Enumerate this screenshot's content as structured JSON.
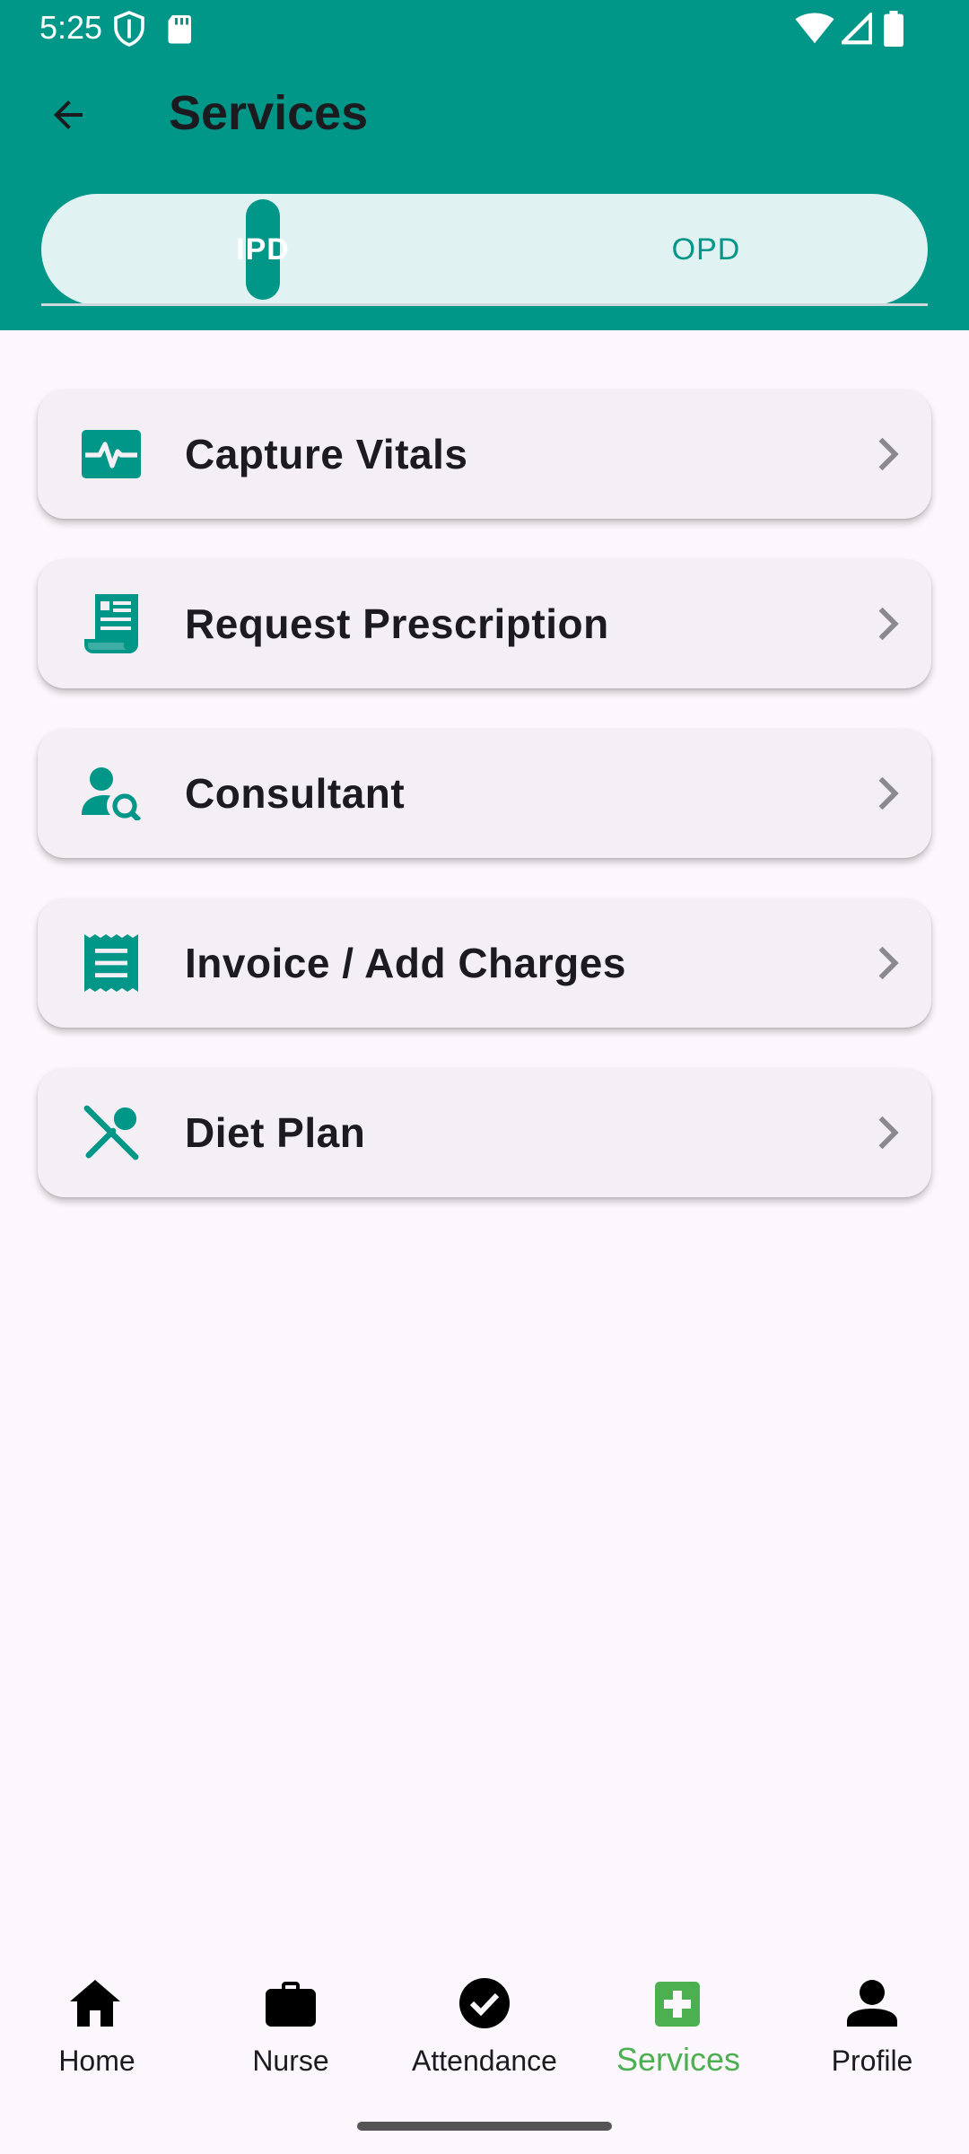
{
  "status_bar": {
    "time": "5:25"
  },
  "header": {
    "title": "Services"
  },
  "tabs": [
    {
      "label": "IPD",
      "selected": true
    },
    {
      "label": "OPD",
      "selected": false
    }
  ],
  "services": [
    {
      "label": "Capture Vitals",
      "icon": "vitals-monitor-icon"
    },
    {
      "label": "Request Prescription",
      "icon": "prescription-receipt-icon"
    },
    {
      "label": "Consultant",
      "icon": "person-search-icon"
    },
    {
      "label": "Invoice / Add Charges",
      "icon": "receipt-icon"
    },
    {
      "label": "Diet Plan",
      "icon": "utensils-icon"
    }
  ],
  "bottom_nav": [
    {
      "label": "Home",
      "icon": "home-icon",
      "active": false
    },
    {
      "label": "Nurse",
      "icon": "briefcase-icon",
      "active": false
    },
    {
      "label": "Attendance",
      "icon": "check-circle-icon",
      "active": false
    },
    {
      "label": "Services",
      "icon": "medical-cross-icon",
      "active": true
    },
    {
      "label": "Profile",
      "icon": "person-icon",
      "active": false
    }
  ],
  "colors": {
    "primary": "#009688",
    "tab_bg": "#e0f2f1",
    "nav_active": "#4caf50",
    "card_bg": "#f3eff5"
  }
}
